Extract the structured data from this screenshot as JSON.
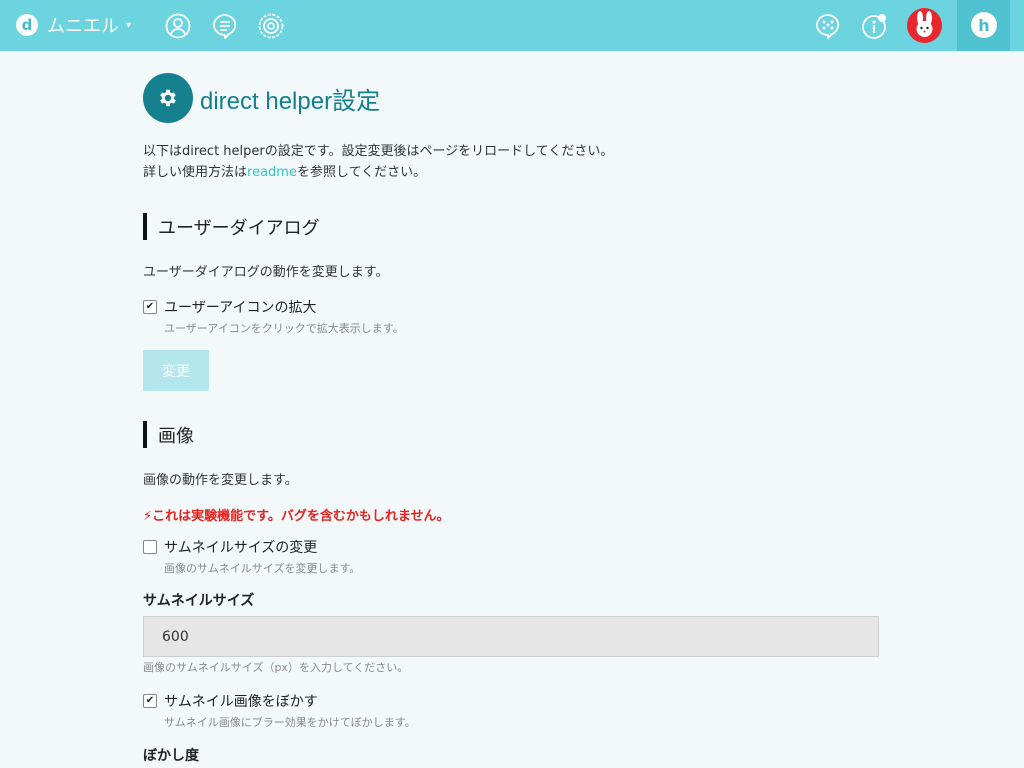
{
  "nav": {
    "brand_letter": "d",
    "org_name": "ムニエル",
    "caret": "▾",
    "user_initial": "h",
    "icons": [
      "user-icon",
      "chat-bubble-icon",
      "gear-icon",
      "apps-icon",
      "info-icon"
    ]
  },
  "page": {
    "title": "direct helper設定",
    "intro_line1": "以下はdirect helperの設定です。設定変更後はページをリロードしてください。",
    "intro_line2_before": "詳しい使用方法は",
    "intro_link": "readme",
    "intro_line2_after": "を参照してください。"
  },
  "user_dialog": {
    "heading": "ユーザーダイアログ",
    "description": "ユーザーダイアログの動作を変更します。",
    "option_label": "ユーザーアイコンの拡大",
    "option_help": "ユーザーアイコンをクリックで拡大表示します。",
    "option_checked": true,
    "check_mark": "✔",
    "button_label": "変更"
  },
  "image": {
    "heading": "画像",
    "description": "画像の動作を変更します。",
    "warning_icon": "⚡",
    "warning": "これは実験機能です。バグを含むかもしれません。",
    "thumb_resize_label": "サムネイルサイズの変更",
    "thumb_resize_help": "画像のサムネイルサイズを変更します。",
    "thumb_resize_checked": false,
    "thumb_size_label": "サムネイルサイズ",
    "thumb_size_value": "600",
    "thumb_size_help": "画像のサムネイルサイズ（px）を入力してください。",
    "blur_label": "サムネイル画像をぼかす",
    "blur_help": "サムネイル画像にブラー効果をかけてぼかします。",
    "blur_checked": true,
    "check_mark": "✔",
    "blur_degree_label": "ぼかし度"
  },
  "colors": {
    "topbar": "#6bd4df",
    "accent": "#15808e",
    "link": "#35c2d2",
    "warning": "#e8221c",
    "button": "#b4e6ed"
  }
}
